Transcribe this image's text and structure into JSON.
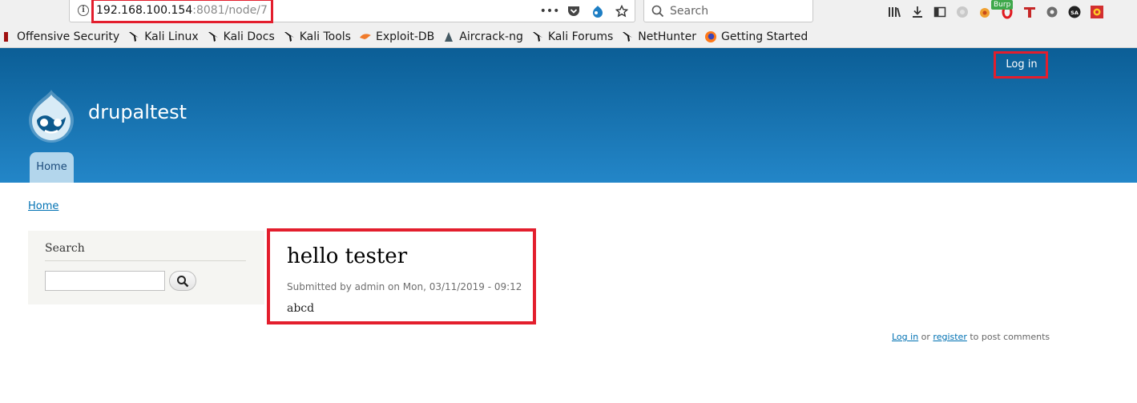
{
  "browser": {
    "url_host": "192.168.100.154",
    "url_rest": ":8081/node/7",
    "search_placeholder": "Search",
    "burp_label": "Burp"
  },
  "bookmarks": [
    {
      "label": "Offensive Security",
      "icon": "offsec-icon"
    },
    {
      "label": "Kali Linux",
      "icon": "kali-dragon-icon"
    },
    {
      "label": "Kali Docs",
      "icon": "kali-dragon-icon"
    },
    {
      "label": "Kali Tools",
      "icon": "kali-dragon-icon"
    },
    {
      "label": "Exploit-DB",
      "icon": "exploitdb-icon"
    },
    {
      "label": "Aircrack-ng",
      "icon": "aircrack-icon"
    },
    {
      "label": "Kali Forums",
      "icon": "kali-dragon-icon"
    },
    {
      "label": "NetHunter",
      "icon": "kali-dragon-icon"
    },
    {
      "label": "Getting Started",
      "icon": "firefox-icon"
    }
  ],
  "site": {
    "login_label": "Log in",
    "name": "drupaltest",
    "home_tab": "Home"
  },
  "breadcrumb": "Home",
  "sidebar": {
    "search_title": "Search"
  },
  "node": {
    "title": "hello tester",
    "submitted": "Submitted by admin on Mon, 03/11/2019 - 09:12",
    "body": "abcd"
  },
  "comments": {
    "login": "Log in",
    "or": " or ",
    "register": "register",
    "suffix": " to post comments"
  },
  "colors": {
    "highlight": "#e31e2d",
    "header_top": "#0b5e96",
    "header_bottom": "#2386c8",
    "link": "#0071b3"
  }
}
